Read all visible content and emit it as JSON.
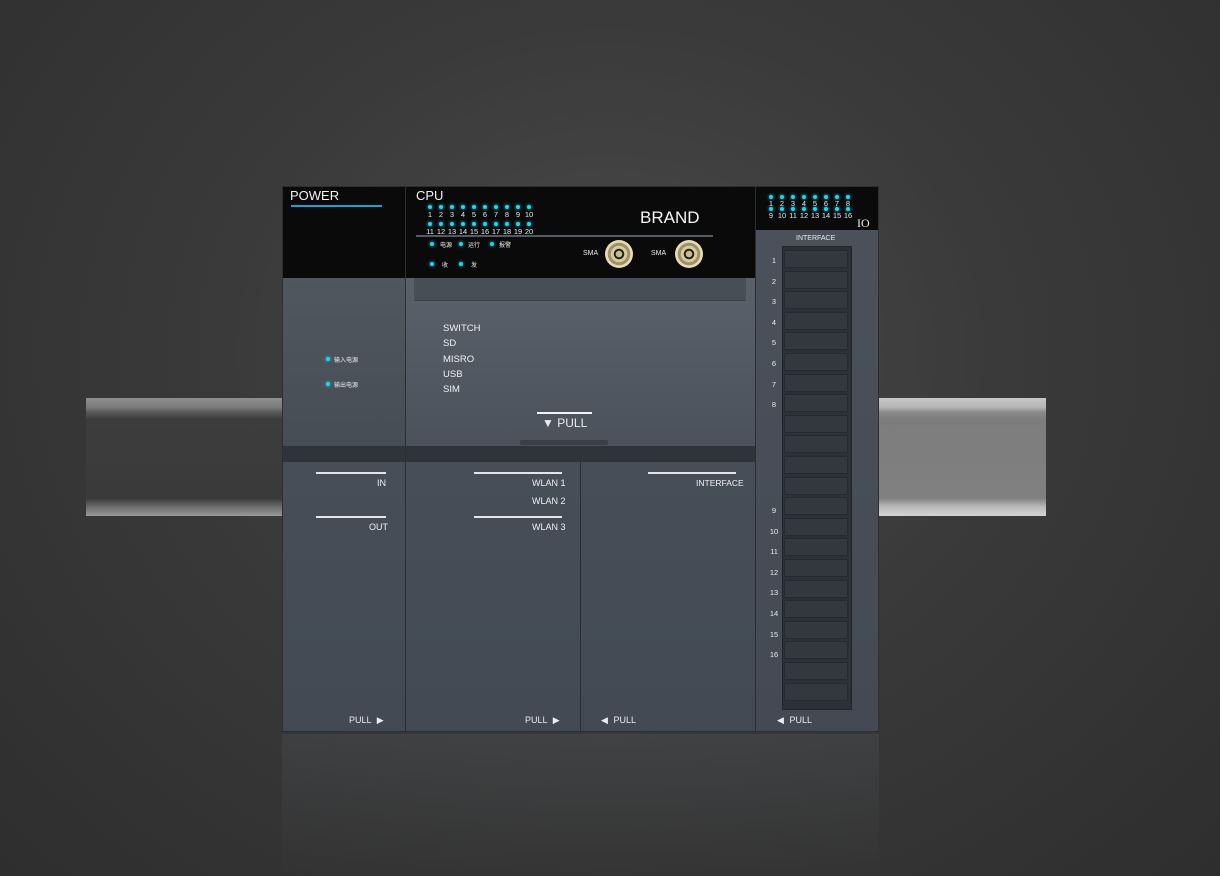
{
  "power": {
    "title": "POWER",
    "input_power": "输入电源",
    "output_power": "输出电源",
    "in_label": "IN",
    "out_label": "OUT",
    "pull_label": "PULL"
  },
  "cpu": {
    "title": "CPU",
    "brand": "BRAND",
    "led_row1": [
      "1",
      "2",
      "3",
      "4",
      "5",
      "6",
      "7",
      "8",
      "9",
      "10"
    ],
    "led_row2": [
      "11",
      "12",
      "13",
      "14",
      "15",
      "16",
      "17",
      "18",
      "19",
      "20"
    ],
    "status": {
      "power": "电源",
      "run": "运行",
      "alarm": "报警",
      "rx": "收",
      "tx": "发"
    },
    "sma_left": "SMA",
    "sma_right": "SMA",
    "ports": [
      "SWITCH",
      "SD",
      "MISRO",
      "USB",
      "SIM"
    ],
    "door_pull": "PULL",
    "wlan1": "WLAN 1",
    "wlan2": "WLAN 2",
    "wlan3": "WLAN 3",
    "pull_label": "PULL",
    "interface_label": "INTERFACE",
    "pull2_label": "PULL"
  },
  "io": {
    "title": "IO",
    "led_row1": [
      "1",
      "2",
      "3",
      "4",
      "5",
      "6",
      "7",
      "8"
    ],
    "led_row2": [
      "9",
      "10",
      "11",
      "12",
      "13",
      "14",
      "15",
      "16"
    ],
    "interface_label": "INTERFACE",
    "terminals_top": [
      "1",
      "2",
      "3",
      "4",
      "5",
      "6",
      "7",
      "8"
    ],
    "terminals_bottom": [
      "9",
      "10",
      "11",
      "12",
      "13",
      "14",
      "15",
      "16"
    ],
    "pull_label": "PULL"
  },
  "colors": {
    "led": "#21d4f0",
    "body": "#4b525c",
    "accent_line": "#1e9fd6"
  }
}
